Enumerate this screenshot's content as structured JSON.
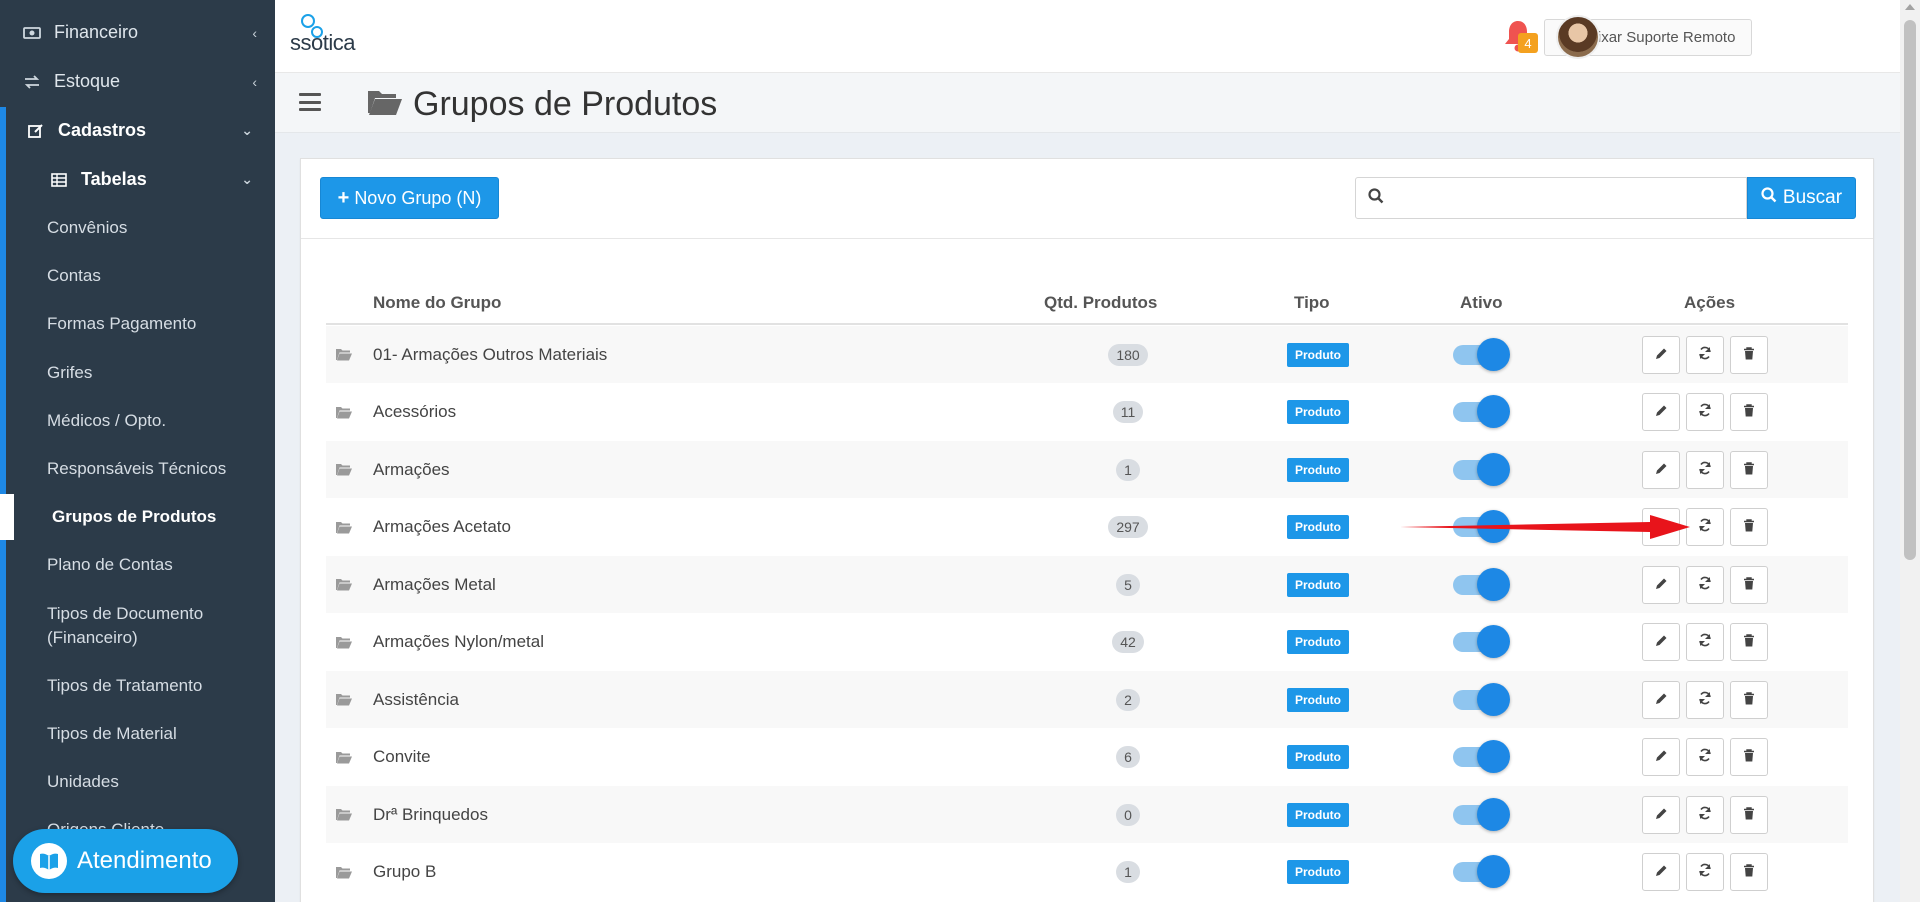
{
  "sidebar": {
    "items": [
      {
        "label": "Financeiro",
        "icon": "money-icon"
      },
      {
        "label": "Estoque",
        "icon": "exchange-icon"
      },
      {
        "label": "Cadastros",
        "icon": "edit-icon"
      },
      {
        "label": "Tabelas",
        "icon": "table-icon"
      }
    ],
    "sub_items": [
      "Convênios",
      "Contas",
      "Formas Pagamento",
      "Grifes",
      "Médicos / Opto.",
      "Responsáveis Técnicos",
      "Grupos de Produtos",
      "Plano de Contas",
      "Tipos de Documento",
      "(Financeiro)",
      "Tipos de Tratamento",
      "Tipos de Material",
      "Unidades",
      "Origens Cliente"
    ],
    "active_item": "Grupos de Produtos"
  },
  "atendimento": {
    "label": "Atendimento"
  },
  "header": {
    "logo_text": "ssotica",
    "remote_support_label": "Baixar Suporte Remoto",
    "notification_count": "4"
  },
  "page": {
    "title": "Grupos de Produtos"
  },
  "toolbar": {
    "new_group_label": "Novo Grupo (N)",
    "search_placeholder": "",
    "search_label": "Buscar"
  },
  "table": {
    "columns": [
      "Nome do Grupo",
      "Qtd. Produtos",
      "Tipo",
      "Ativo",
      "Ações"
    ],
    "rows": [
      {
        "name": "01- Armações Outros Materiais",
        "qty": "180",
        "tipo": "Produto",
        "ativo": true
      },
      {
        "name": "Acessórios",
        "qty": "11",
        "tipo": "Produto",
        "ativo": true
      },
      {
        "name": "Armações",
        "qty": "1",
        "tipo": "Produto",
        "ativo": true
      },
      {
        "name": "Armações Acetato",
        "qty": "297",
        "tipo": "Produto",
        "ativo": true
      },
      {
        "name": "Armações Metal",
        "qty": "5",
        "tipo": "Produto",
        "ativo": true
      },
      {
        "name": "Armações Nylon/metal",
        "qty": "42",
        "tipo": "Produto",
        "ativo": true
      },
      {
        "name": "Assistência",
        "qty": "2",
        "tipo": "Produto",
        "ativo": true
      },
      {
        "name": "Convite",
        "qty": "6",
        "tipo": "Produto",
        "ativo": true
      },
      {
        "name": "Drª Brinquedos",
        "qty": "0",
        "tipo": "Produto",
        "ativo": true
      },
      {
        "name": "Grupo B",
        "qty": "1",
        "tipo": "Produto",
        "ativo": true
      }
    ]
  },
  "colors": {
    "primary": "#1d97e8",
    "sidebar_bg": "#2c3b49",
    "toggle_on": "#1d88e5",
    "annotation_arrow": "#e8141b"
  }
}
